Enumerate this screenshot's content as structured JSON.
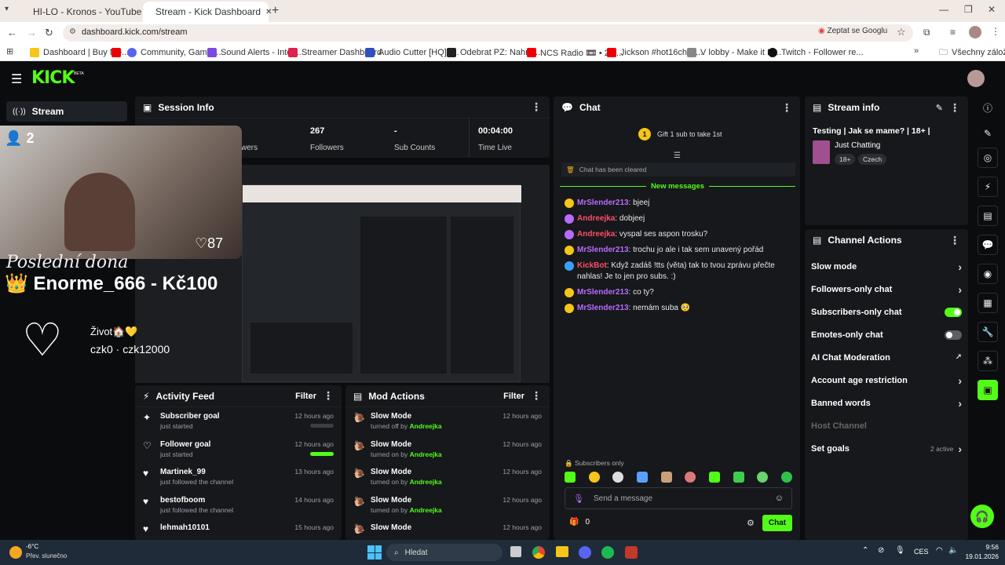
{
  "browser": {
    "tabs": [
      {
        "label": "HI-LO - Kronos - YouTube"
      },
      {
        "label": "Stream - Kick Dashboard"
      }
    ],
    "url": "dashboard.kick.com/stream",
    "google_pill": "Zeptat se Googlu",
    "bookmarks": [
      "Dashboard | Buy Me...",
      "Community, Gamin...",
      "Sound Alerts - Inter...",
      "Streamer Dashboard",
      "Audio Cutter [HQ] -...",
      "Odebrat PZ: Nahrát...",
      "NCS Radio 📼 • 24/...",
      "Jickson #hot16chall...",
      "V lobby - Make it M...",
      "Twitch - Follower re..."
    ],
    "all_bookmarks": "Všechny záložky"
  },
  "app": {
    "logo": "KICK",
    "logo_badge": "BETA",
    "nav_stream": "Stream",
    "session": {
      "title": "Session Info",
      "stats": [
        {
          "value": "",
          "label": "wers"
        },
        {
          "value": "267",
          "label": "Followers"
        },
        {
          "value": "-",
          "label": "Sub Counts"
        },
        {
          "value": "00:04:00",
          "label": "Time Live"
        }
      ]
    },
    "overlay": {
      "viewers": "2",
      "banner": "Poslední dona",
      "name_line": "👑 Enorme_666 - Kč100",
      "likes": "87",
      "zivot": "Život🏠💛",
      "accounts": "czk0 · czk12000"
    },
    "chat": {
      "title": "Chat",
      "gift": "Gift 1 sub to take 1st",
      "cleared": "Chat has been cleared",
      "new_messages": "New messages",
      "messages": [
        {
          "user": "MrSlender213",
          "text": "bjeej",
          "color": "#b86bff",
          "badge": "#f5c518"
        },
        {
          "user": "Andreejka",
          "text": "dobjeej",
          "color": "#ff4d6a",
          "badge": "#b86bff"
        },
        {
          "user": "Andreejka",
          "text": "vyspal ses aspon trosku?",
          "color": "#ff4d6a",
          "badge": "#b86bff"
        },
        {
          "user": "MrSlender213",
          "text": "trochu jo ale i tak sem unavený pořád",
          "color": "#b86bff",
          "badge": "#f5c518"
        },
        {
          "user": "KickBot",
          "text": "Když zadáš !tts (věta) tak to tvou zprávu přečte nahlas! Je to jen pro subs. :)",
          "color": "#ff4d6a",
          "badge": "#3aa0ff"
        },
        {
          "user": "MrSlender213",
          "text": "co ty?",
          "color": "#b86bff",
          "badge": "#f5c518"
        },
        {
          "user": "MrSlender213",
          "text": "nemám suba 🥺",
          "color": "#b86bff",
          "badge": "#f5c518"
        }
      ],
      "subs_only": "Subscribers only",
      "placeholder": "Send a message",
      "count": "0",
      "send": "Chat"
    },
    "stream_info": {
      "title": "Stream info",
      "stream_title": "Testing | Jak se mame? | 18+ |",
      "category": "Just Chatting",
      "tags": [
        "18+",
        "Czech"
      ]
    },
    "channel_actions": {
      "title": "Channel Actions",
      "items": [
        {
          "label": "Slow mode",
          "type": "chevron"
        },
        {
          "label": "Followers-only chat",
          "type": "chevron"
        },
        {
          "label": "Subscribers-only chat",
          "type": "toggle",
          "on": true
        },
        {
          "label": "Emotes-only chat",
          "type": "toggle",
          "on": false
        },
        {
          "label": "AI Chat Moderation",
          "type": "external"
        },
        {
          "label": "Account age restriction",
          "type": "chevron"
        },
        {
          "label": "Banned words",
          "type": "chevron"
        },
        {
          "label": "Host Channel",
          "type": "disabled"
        },
        {
          "label": "Set goals",
          "type": "chevron",
          "status": "2 active"
        }
      ]
    },
    "activity": {
      "title": "Activity Feed",
      "filter": "Filter",
      "items": [
        {
          "title": "Subscriber goal",
          "sub": "just started",
          "time": "12 hours ago",
          "progress": 0
        },
        {
          "title": "Follower goal",
          "sub": "just started",
          "time": "12 hours ago",
          "progress": 1
        },
        {
          "title": "Martinek_99",
          "sub": "just followed the channel",
          "time": "13 hours ago"
        },
        {
          "title": "bestofboom",
          "sub": "just followed the channel",
          "time": "14 hours ago"
        },
        {
          "title": "lehmah10101",
          "sub": "",
          "time": "15 hours ago"
        }
      ]
    },
    "mod": {
      "title": "Mod Actions",
      "filter": "Filter",
      "items": [
        {
          "title": "Slow Mode",
          "sub": "turned off by",
          "by": "Andreejka",
          "time": "12 hours ago"
        },
        {
          "title": "Slow Mode",
          "sub": "turned on by",
          "by": "Andreejka",
          "time": "12 hours ago"
        },
        {
          "title": "Slow Mode",
          "sub": "turned on by",
          "by": "Andreejka",
          "time": "12 hours ago"
        },
        {
          "title": "Slow Mode",
          "sub": "turned on by",
          "by": "Andreejka",
          "time": "12 hours ago"
        },
        {
          "title": "Slow Mode",
          "sub": "",
          "by": "",
          "time": "12 hours ago"
        }
      ]
    }
  },
  "taskbar": {
    "weather_temp": "-6°C",
    "weather_desc": "Přev. slunečno",
    "search": "Hledat",
    "lang": "CES",
    "time": "9:56",
    "date": "19.01.2026"
  }
}
